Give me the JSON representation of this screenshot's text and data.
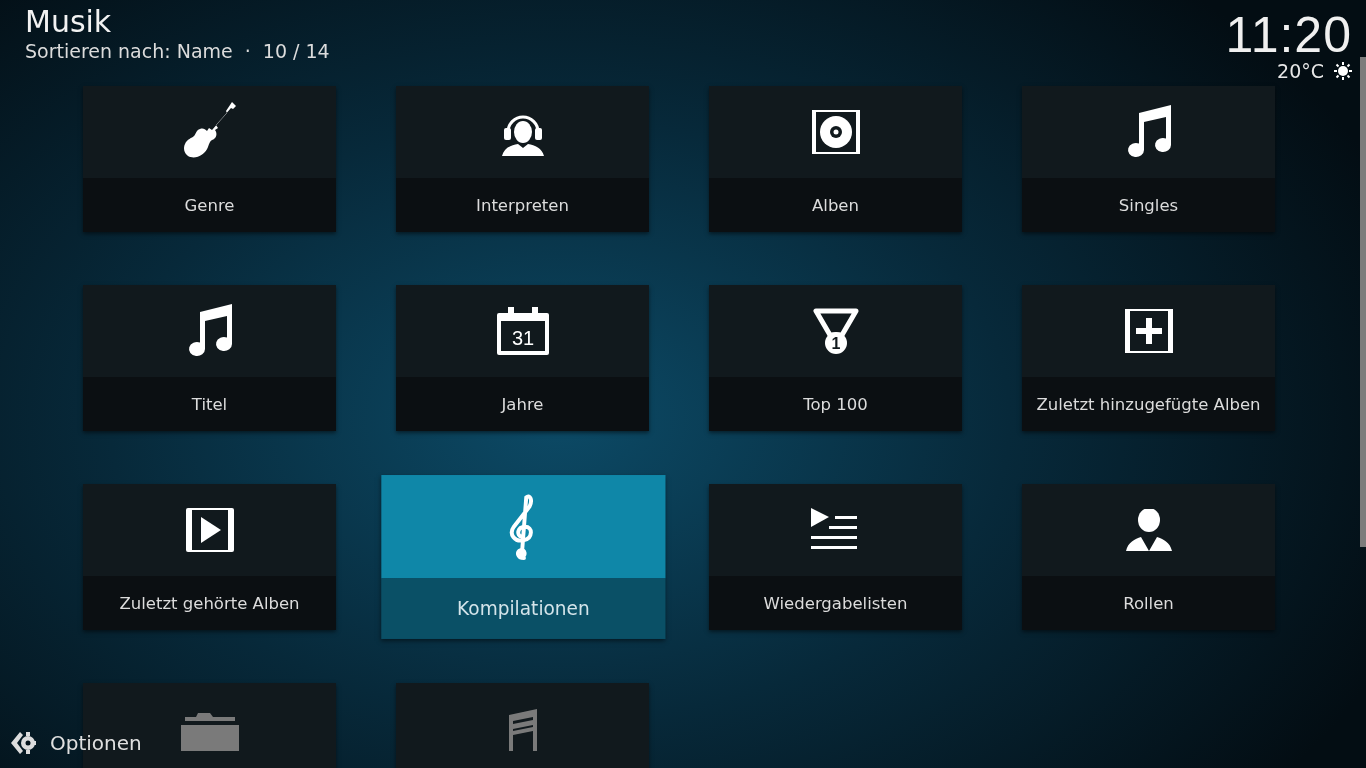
{
  "header": {
    "title": "Musik",
    "sort": "Sortieren nach: Name",
    "separator": "·",
    "position": "10 / 14"
  },
  "clock": {
    "time": "11:20",
    "temperature": "20°C"
  },
  "tiles": [
    {
      "label": "Genre",
      "kind": "guitar",
      "selected": false
    },
    {
      "label": "Interpreten",
      "kind": "headphones",
      "selected": false
    },
    {
      "label": "Alben",
      "kind": "disc",
      "selected": false
    },
    {
      "label": "Singles",
      "kind": "note",
      "selected": false
    },
    {
      "label": "Titel",
      "kind": "note",
      "selected": false
    },
    {
      "label": "Jahre",
      "kind": "calendar",
      "icon_text": "31",
      "selected": false
    },
    {
      "label": "Top 100",
      "kind": "medal",
      "icon_text": "1",
      "selected": false
    },
    {
      "label": "Zuletzt hinzugefügte Alben",
      "kind": "plus",
      "selected": false
    },
    {
      "label": "Zuletzt gehörte Alben",
      "kind": "play",
      "selected": false
    },
    {
      "label": "Kompilationen",
      "kind": "clef",
      "selected": true
    },
    {
      "label": "Wiedergabelisten",
      "kind": "playlist",
      "selected": false
    },
    {
      "label": "Rollen",
      "kind": "person",
      "selected": false
    },
    {
      "kind": "folder",
      "selected": false
    },
    {
      "kind": "sheet",
      "selected": false
    }
  ],
  "options": {
    "label": "Optionen"
  }
}
